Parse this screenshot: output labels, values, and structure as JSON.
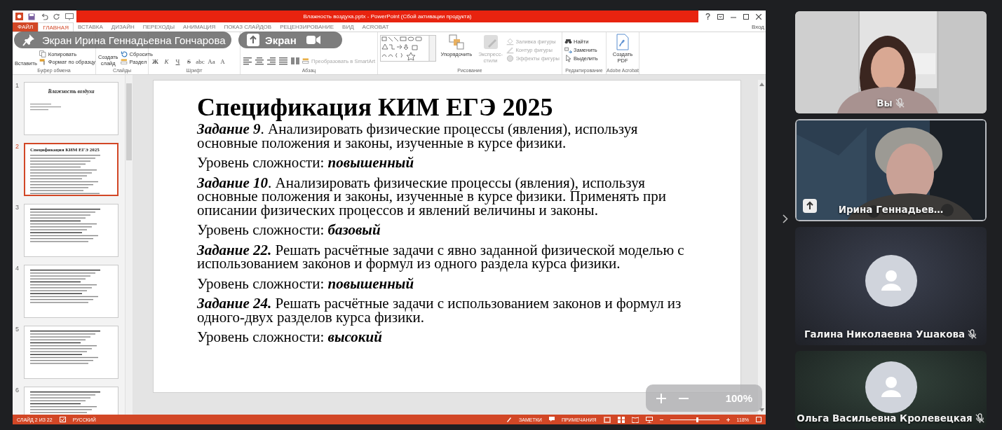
{
  "window": {
    "title": "Влажность воздуха.pptx - PowerPoint (Сбой активации продукта)",
    "sign_in": "Вход"
  },
  "ribbon_tabs": [
    {
      "label": "ФАЙЛ",
      "kind": "file",
      "selected": false
    },
    {
      "label": "ГЛАВНАЯ",
      "kind": "tab",
      "selected": true
    },
    {
      "label": "ВСТАВКА",
      "kind": "tab",
      "selected": false
    },
    {
      "label": "ДИЗАЙН",
      "kind": "tab",
      "selected": false
    },
    {
      "label": "ПЕРЕХОДЫ",
      "kind": "tab",
      "selected": false
    },
    {
      "label": "АНИМАЦИЯ",
      "kind": "tab",
      "selected": false
    },
    {
      "label": "ПОКАЗ СЛАЙДОВ",
      "kind": "tab",
      "selected": false
    },
    {
      "label": "РЕЦЕНЗИРОВАНИЕ",
      "kind": "tab",
      "selected": false
    },
    {
      "label": "ВИД",
      "kind": "tab",
      "selected": false
    },
    {
      "label": "ACROBAT",
      "kind": "tab",
      "selected": false
    }
  ],
  "ribbon_groups": [
    {
      "label": "Буфер обмена",
      "kind": "clipboard",
      "items": [
        {
          "label": "Вставить",
          "disabled": false
        },
        {
          "label": "Копировать",
          "disabled": false
        },
        {
          "label": "Формат по образцу",
          "disabled": false
        }
      ]
    },
    {
      "label": "Слайды",
      "kind": "slides",
      "items": [
        {
          "label": "Создать слайд",
          "disabled": false
        },
        {
          "label": "Сбросить",
          "disabled": false
        },
        {
          "label": "Раздел",
          "disabled": false
        }
      ]
    },
    {
      "label": "Шрифт",
      "kind": "font",
      "items": [
        {
          "label": "Ж"
        },
        {
          "label": "К"
        },
        {
          "label": "Ч"
        },
        {
          "label": "S"
        },
        {
          "label": "abc"
        },
        {
          "label": "Aa"
        },
        {
          "label": "A"
        }
      ]
    },
    {
      "label": "Абзац",
      "kind": "paragraph",
      "items": [
        {
          "label": "Преобразовать в SmartArt",
          "disabled": true
        }
      ]
    },
    {
      "label": "Рисование",
      "kind": "drawing",
      "items": [
        {
          "label": "Упорядочить",
          "disabled": false
        },
        {
          "label": "Экспресс-стили",
          "disabled": true
        },
        {
          "label": "Заливка фигуры",
          "disabled": true
        },
        {
          "label": "Контур фигуры",
          "disabled": true
        },
        {
          "label": "Эффекты фигуры",
          "disabled": true
        }
      ]
    },
    {
      "label": "Редактирование",
      "kind": "editing",
      "items": [
        {
          "label": "Найти",
          "disabled": false
        },
        {
          "label": "Заменить",
          "disabled": false
        },
        {
          "label": "Выделить",
          "disabled": false
        }
      ]
    },
    {
      "label": "Adobe Acrobat",
      "kind": "acrobat",
      "items": [
        {
          "label": "Создать PDF",
          "disabled": false
        }
      ]
    }
  ],
  "screen_share_bar": {
    "presenter": "Экран Ирина Геннадьевна Гончарова",
    "share_button": "Экран"
  },
  "thumbnails": [
    {
      "number": "1",
      "title": "Влажность воздуха",
      "selected": false
    },
    {
      "number": "2",
      "title": "Спецификация КИМ ЕГЭ 2025",
      "selected": true
    },
    {
      "number": "3",
      "selected": false
    },
    {
      "number": "4",
      "selected": false
    },
    {
      "number": "5",
      "selected": false
    },
    {
      "number": "6",
      "selected": false
    }
  ],
  "slide": {
    "title": "Спецификация КИМ ЕГЭ 2025",
    "blocks": [
      {
        "kind": "task",
        "label": "Задание 9",
        "text": ". Анализировать физические процессы (явления), используя основные положения и законы, изученные в курсе физики."
      },
      {
        "kind": "level",
        "label": "Уровень сложности: ",
        "value": "повышенный"
      },
      {
        "kind": "task",
        "label": "Задание 10",
        "text": ". Анализировать физические процессы (явления), используя основные положения и законы, изученные в курсе физики. Применять при описании физических процессов и явлений величины и законы."
      },
      {
        "kind": "level",
        "label": "Уровень сложности: ",
        "value": "базовый"
      },
      {
        "kind": "task",
        "label": "Задание 22.",
        "text": " Решать расчётные задачи с явно заданной физической моделью с использованием законов и формул из одного раздела курса физики."
      },
      {
        "kind": "level",
        "label": "Уровень сложности: ",
        "value": "повышенный"
      },
      {
        "kind": "task",
        "label": "Задание 24.",
        "text": " Решать расчётные задачи с использованием законов и формул из одного-двух разделов курса физики."
      },
      {
        "kind": "level",
        "label": "Уровень сложности: ",
        "value": "высокий"
      }
    ]
  },
  "zoom_overlay": {
    "value": "100%"
  },
  "status_bar": {
    "slide": "СЛАЙД 2 ИЗ 22",
    "language": "РУССКИЙ",
    "notes": "ЗАМЕТКИ",
    "comments": "ПРИМЕЧАНИЯ",
    "zoom": "118%",
    "zoom_slider": {
      "level": 0.55
    }
  },
  "participants": [
    {
      "name": "Вы",
      "kind": "video",
      "muted": true,
      "sharing": false,
      "speaking": false
    },
    {
      "name": "Ирина Геннадьев…",
      "kind": "video",
      "muted": false,
      "sharing": true,
      "speaking": true
    },
    {
      "name": "Галина Николаевна Ушакова",
      "kind": "avatar",
      "muted": true,
      "sharing": false,
      "speaking": false
    },
    {
      "name": "Ольга Васильевна Кролевецкая",
      "kind": "avatar",
      "muted": true,
      "sharing": false,
      "speaking": false
    }
  ]
}
